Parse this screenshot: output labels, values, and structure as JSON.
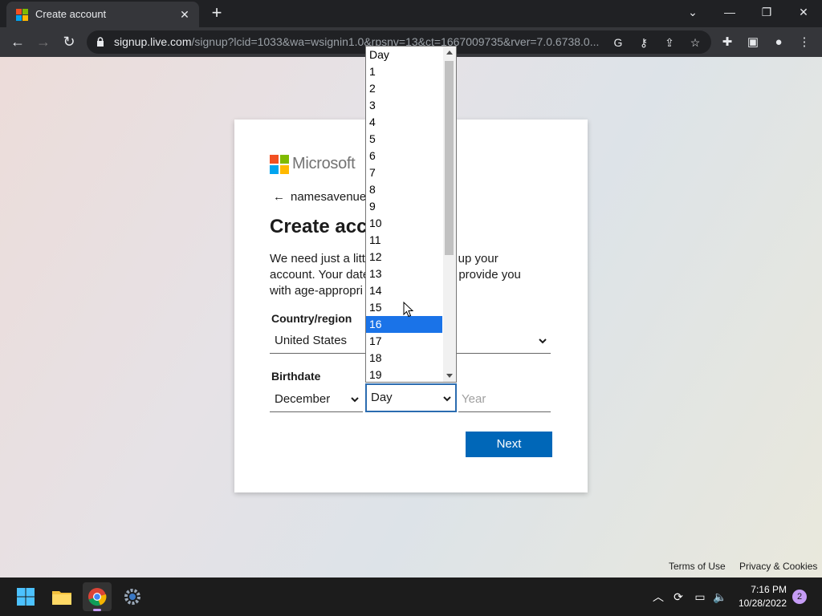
{
  "browser": {
    "tab_title": "Create account",
    "url_host": "signup.live.com",
    "url_rest": "/signup?lcid=1033&wa=wsignin1.0&rpsnv=13&ct=1667009735&rver=7.0.6738.0..."
  },
  "card": {
    "brand": "Microsoft",
    "identity": "namesavenue(",
    "title": "Create acco",
    "description_left_1": "We need just a litt",
    "description_right_1": "et up your",
    "description_left_2": "account. Your date",
    "description_right_2": "s to provide you",
    "description_left_3": "with age-appropri",
    "country_label": "Country/region",
    "country_value": "United States",
    "birthdate_label": "Birthdate",
    "month_value": "December",
    "day_value": "Day",
    "year_placeholder": "Year",
    "next_label": "Next"
  },
  "day_dropdown": {
    "options": [
      "Day",
      "1",
      "2",
      "3",
      "4",
      "5",
      "6",
      "7",
      "8",
      "9",
      "10",
      "11",
      "12",
      "13",
      "14",
      "15",
      "16",
      "17",
      "18",
      "19"
    ],
    "highlighted": "16"
  },
  "footer": {
    "terms": "Terms of Use",
    "privacy": "Privacy & Cookies"
  },
  "taskbar": {
    "time": "7:16 PM",
    "date": "10/28/2022",
    "notification_count": "2"
  },
  "colors": {
    "accent": "#0067b8",
    "highlight": "#1a73e8"
  }
}
